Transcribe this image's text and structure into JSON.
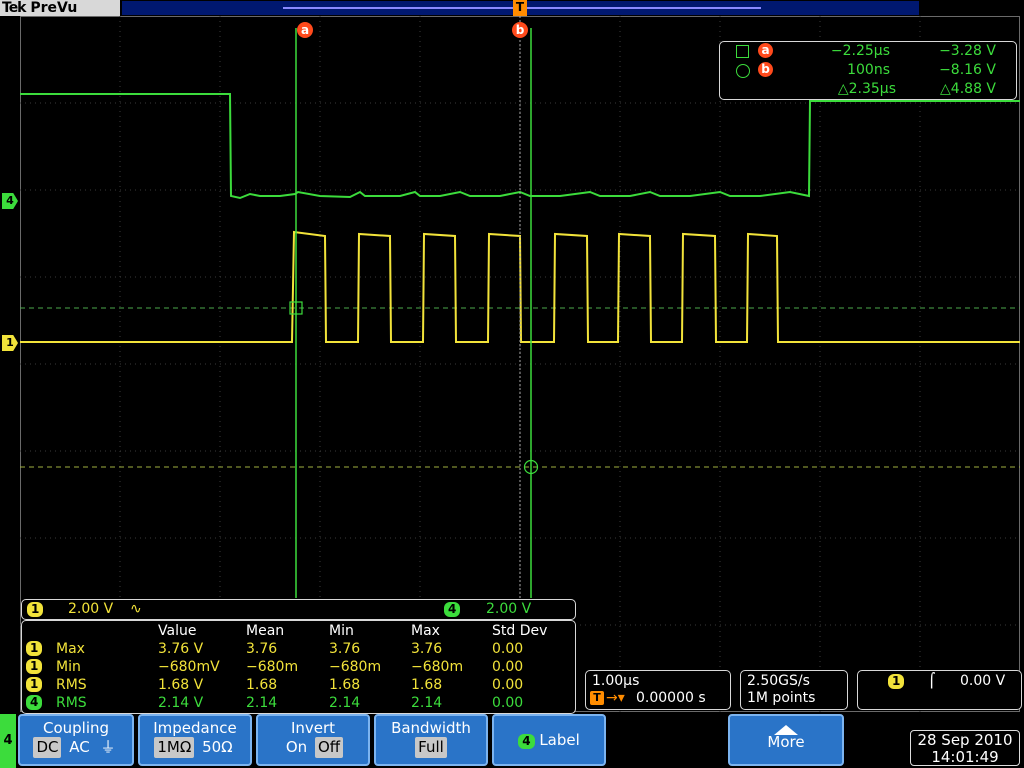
{
  "brand": {
    "vendor": "Tek",
    "mode": "PreVu"
  },
  "trigger_marker": "T",
  "cursors": {
    "a_label": "a",
    "b_label": "b",
    "readout": {
      "a_time": "−2.25µs",
      "a_volt": "−3.28 V",
      "b_time": "100ns",
      "b_volt": "−8.16 V",
      "delta_time": "△2.35µs",
      "delta_volt": "△4.88 V"
    }
  },
  "channel_markers": {
    "ch1": "1",
    "ch4": "4"
  },
  "scale": {
    "ch1_scale": "2.00 V",
    "ch1_bw_symbol": "∿",
    "ch4_scale": "2.00 V"
  },
  "measurements": {
    "headers": [
      "Value",
      "Mean",
      "Min",
      "Max",
      "Std Dev"
    ],
    "rows": [
      {
        "ch": "1",
        "name": "Max",
        "value": "3.76 V",
        "mean": "3.76",
        "min": "3.76",
        "max": "3.76",
        "std": "0.00"
      },
      {
        "ch": "1",
        "name": "Min",
        "value": "−680mV",
        "mean": "−680m",
        "min": "−680m",
        "max": "−680m",
        "std": "0.00"
      },
      {
        "ch": "1",
        "name": "RMS",
        "value": "1.68 V",
        "mean": "1.68",
        "min": "1.68",
        "max": "1.68",
        "std": "0.00"
      },
      {
        "ch": "4",
        "name": "RMS",
        "value": "2.14 V",
        "mean": "2.14",
        "min": "2.14",
        "max": "2.14",
        "std": "0.00"
      }
    ]
  },
  "horizontal": {
    "timebase": "1.00µs",
    "delay": "0.00000 s"
  },
  "acquisition": {
    "rate": "2.50GS/s",
    "points": "1M points"
  },
  "trigger": {
    "source": "1",
    "level": "0.00 V"
  },
  "menu": {
    "channel": "4",
    "coupling": {
      "label": "Coupling",
      "opts": [
        "DC",
        "AC",
        "⏚"
      ]
    },
    "impedance": {
      "label": "Impedance",
      "opts": [
        "1MΩ",
        "50Ω"
      ]
    },
    "invert": {
      "label": "Invert",
      "opts": [
        "On",
        "Off"
      ]
    },
    "bandwidth": {
      "label": "Bandwidth",
      "value": "Full"
    },
    "label_btn": {
      "ch": "4",
      "label": "Label"
    },
    "more": {
      "label": "More"
    }
  },
  "datetime": {
    "date": "28 Sep  2010",
    "time": "14:01:49"
  },
  "colors": {
    "ch1": "#f2e33a",
    "ch4": "#3cdc3c",
    "cursor": "#ff4a1c",
    "menu": "#2a74c8"
  }
}
